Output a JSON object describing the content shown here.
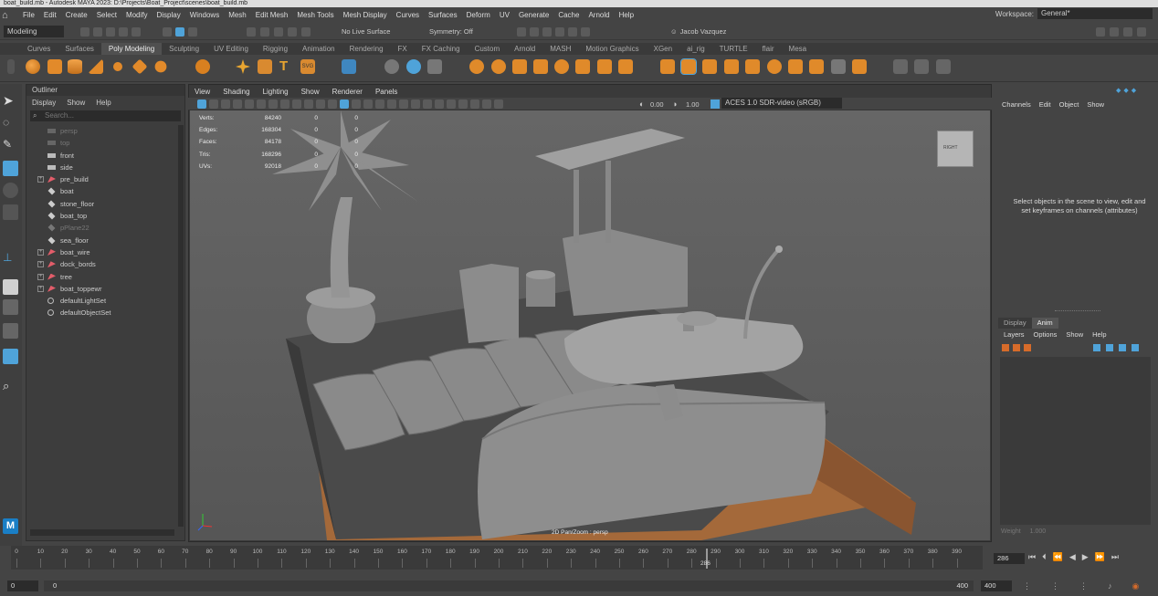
{
  "title_bar": "boat_build.mb - Autodesk MAYA 2023: D:\\Projects\\Boat_Project\\scenes\\boat_build.mb",
  "menu": [
    "File",
    "Edit",
    "Create",
    "Select",
    "Modify",
    "Display",
    "Windows",
    "Mesh",
    "Edit Mesh",
    "Mesh Tools",
    "Mesh Display",
    "Curves",
    "Surfaces",
    "Deform",
    "UV",
    "Generate",
    "Cache",
    "Arnold",
    "Help"
  ],
  "workspace": {
    "label": "Workspace:",
    "value": "General*"
  },
  "status_line": {
    "mode": "Modeling",
    "live_surface": "No Live Surface",
    "symmetry": "Symmetry: Off",
    "user": "Jacob Vazquez"
  },
  "shelf_tabs": [
    "Curves",
    "Surfaces",
    "Poly Modeling",
    "Sculpting",
    "UV Editing",
    "Rigging",
    "Animation",
    "Rendering",
    "FX",
    "FX Caching",
    "Custom",
    "Arnold",
    "MASH",
    "Motion Graphics",
    "XGen",
    "ai_rig",
    "TURTLE",
    "flair",
    "Mesa"
  ],
  "active_shelf_tab": "Poly Modeling",
  "outliner": {
    "title": "Outliner",
    "menu": [
      "Display",
      "Show",
      "Help"
    ],
    "search_placeholder": "Search...",
    "items": [
      {
        "label": "persp",
        "type": "camera",
        "dim": true,
        "expandable": false
      },
      {
        "label": "top",
        "type": "camera",
        "dim": true,
        "expandable": false
      },
      {
        "label": "front",
        "type": "camera",
        "dim": false,
        "expandable": false
      },
      {
        "label": "side",
        "type": "camera",
        "dim": false,
        "expandable": false
      },
      {
        "label": "pre_build",
        "type": "group",
        "dim": false,
        "expandable": true
      },
      {
        "label": "boat",
        "type": "mesh",
        "dim": false,
        "expandable": false
      },
      {
        "label": "stone_floor",
        "type": "mesh",
        "dim": false,
        "expandable": false
      },
      {
        "label": "boat_top",
        "type": "mesh",
        "dim": false,
        "expandable": false
      },
      {
        "label": "pPlane22",
        "type": "mesh",
        "dim": true,
        "expandable": false
      },
      {
        "label": "sea_floor",
        "type": "mesh",
        "dim": false,
        "expandable": false
      },
      {
        "label": "boat_wire",
        "type": "group",
        "dim": false,
        "expandable": true
      },
      {
        "label": "dock_bords",
        "type": "group",
        "dim": false,
        "expandable": true
      },
      {
        "label": "tree",
        "type": "group",
        "dim": false,
        "expandable": true
      },
      {
        "label": "boat_toppewr",
        "type": "group",
        "dim": false,
        "expandable": true
      },
      {
        "label": "defaultLightSet",
        "type": "set",
        "dim": false,
        "expandable": false
      },
      {
        "label": "defaultObjectSet",
        "type": "set",
        "dim": false,
        "expandable": false
      }
    ]
  },
  "viewport": {
    "menu": [
      "View",
      "Shading",
      "Lighting",
      "Show",
      "Renderer",
      "Panels"
    ],
    "exposure": "0.00",
    "gamma": "1.00",
    "color_space": "ACES 1.0 SDR-video (sRGB)",
    "hud": [
      {
        "label": "Verts:",
        "a": "84240",
        "b": "0",
        "c": "0"
      },
      {
        "label": "Edges:",
        "a": "168304",
        "b": "0",
        "c": "0"
      },
      {
        "label": "Faces:",
        "a": "84178",
        "b": "0",
        "c": "0"
      },
      {
        "label": "Tris:",
        "a": "168296",
        "b": "0",
        "c": "0"
      },
      {
        "label": "UVs:",
        "a": "92018",
        "b": "0",
        "c": "0"
      }
    ],
    "status": "2D Pan/Zoom : persp",
    "view_cube": "RIGHT"
  },
  "channel_box": {
    "menu": [
      "Channels",
      "Edit",
      "Object",
      "Show"
    ],
    "message": "Select objects in the scene to view, edit and set keyframes on channels (attributes)"
  },
  "layer_editor": {
    "tabs": [
      "Display",
      "Anim"
    ],
    "active_tab": "Anim",
    "menu": [
      "Layers",
      "Options",
      "Show",
      "Help"
    ],
    "weight_label": "Weight",
    "weight_value": "1.000"
  },
  "timeline": {
    "ticks": [
      "0",
      "10",
      "20",
      "30",
      "40",
      "50",
      "60",
      "70",
      "80",
      "90",
      "100",
      "110",
      "120",
      "130",
      "140",
      "150",
      "160",
      "170",
      "180",
      "190",
      "200",
      "210",
      "220",
      "230",
      "240",
      "250",
      "260",
      "270",
      "280",
      "290",
      "300",
      "310",
      "320",
      "330",
      "340",
      "350",
      "360",
      "370",
      "380",
      "390"
    ],
    "current_frame": "286",
    "playhead_label": "286"
  },
  "range": {
    "start": "0",
    "inner_start": "0",
    "inner_end": "400",
    "end": "400"
  },
  "colors": {
    "accent": "#4fa3d9",
    "bg": "#444444",
    "viewport": "#5f5f5f",
    "wood": "#a4693a"
  }
}
